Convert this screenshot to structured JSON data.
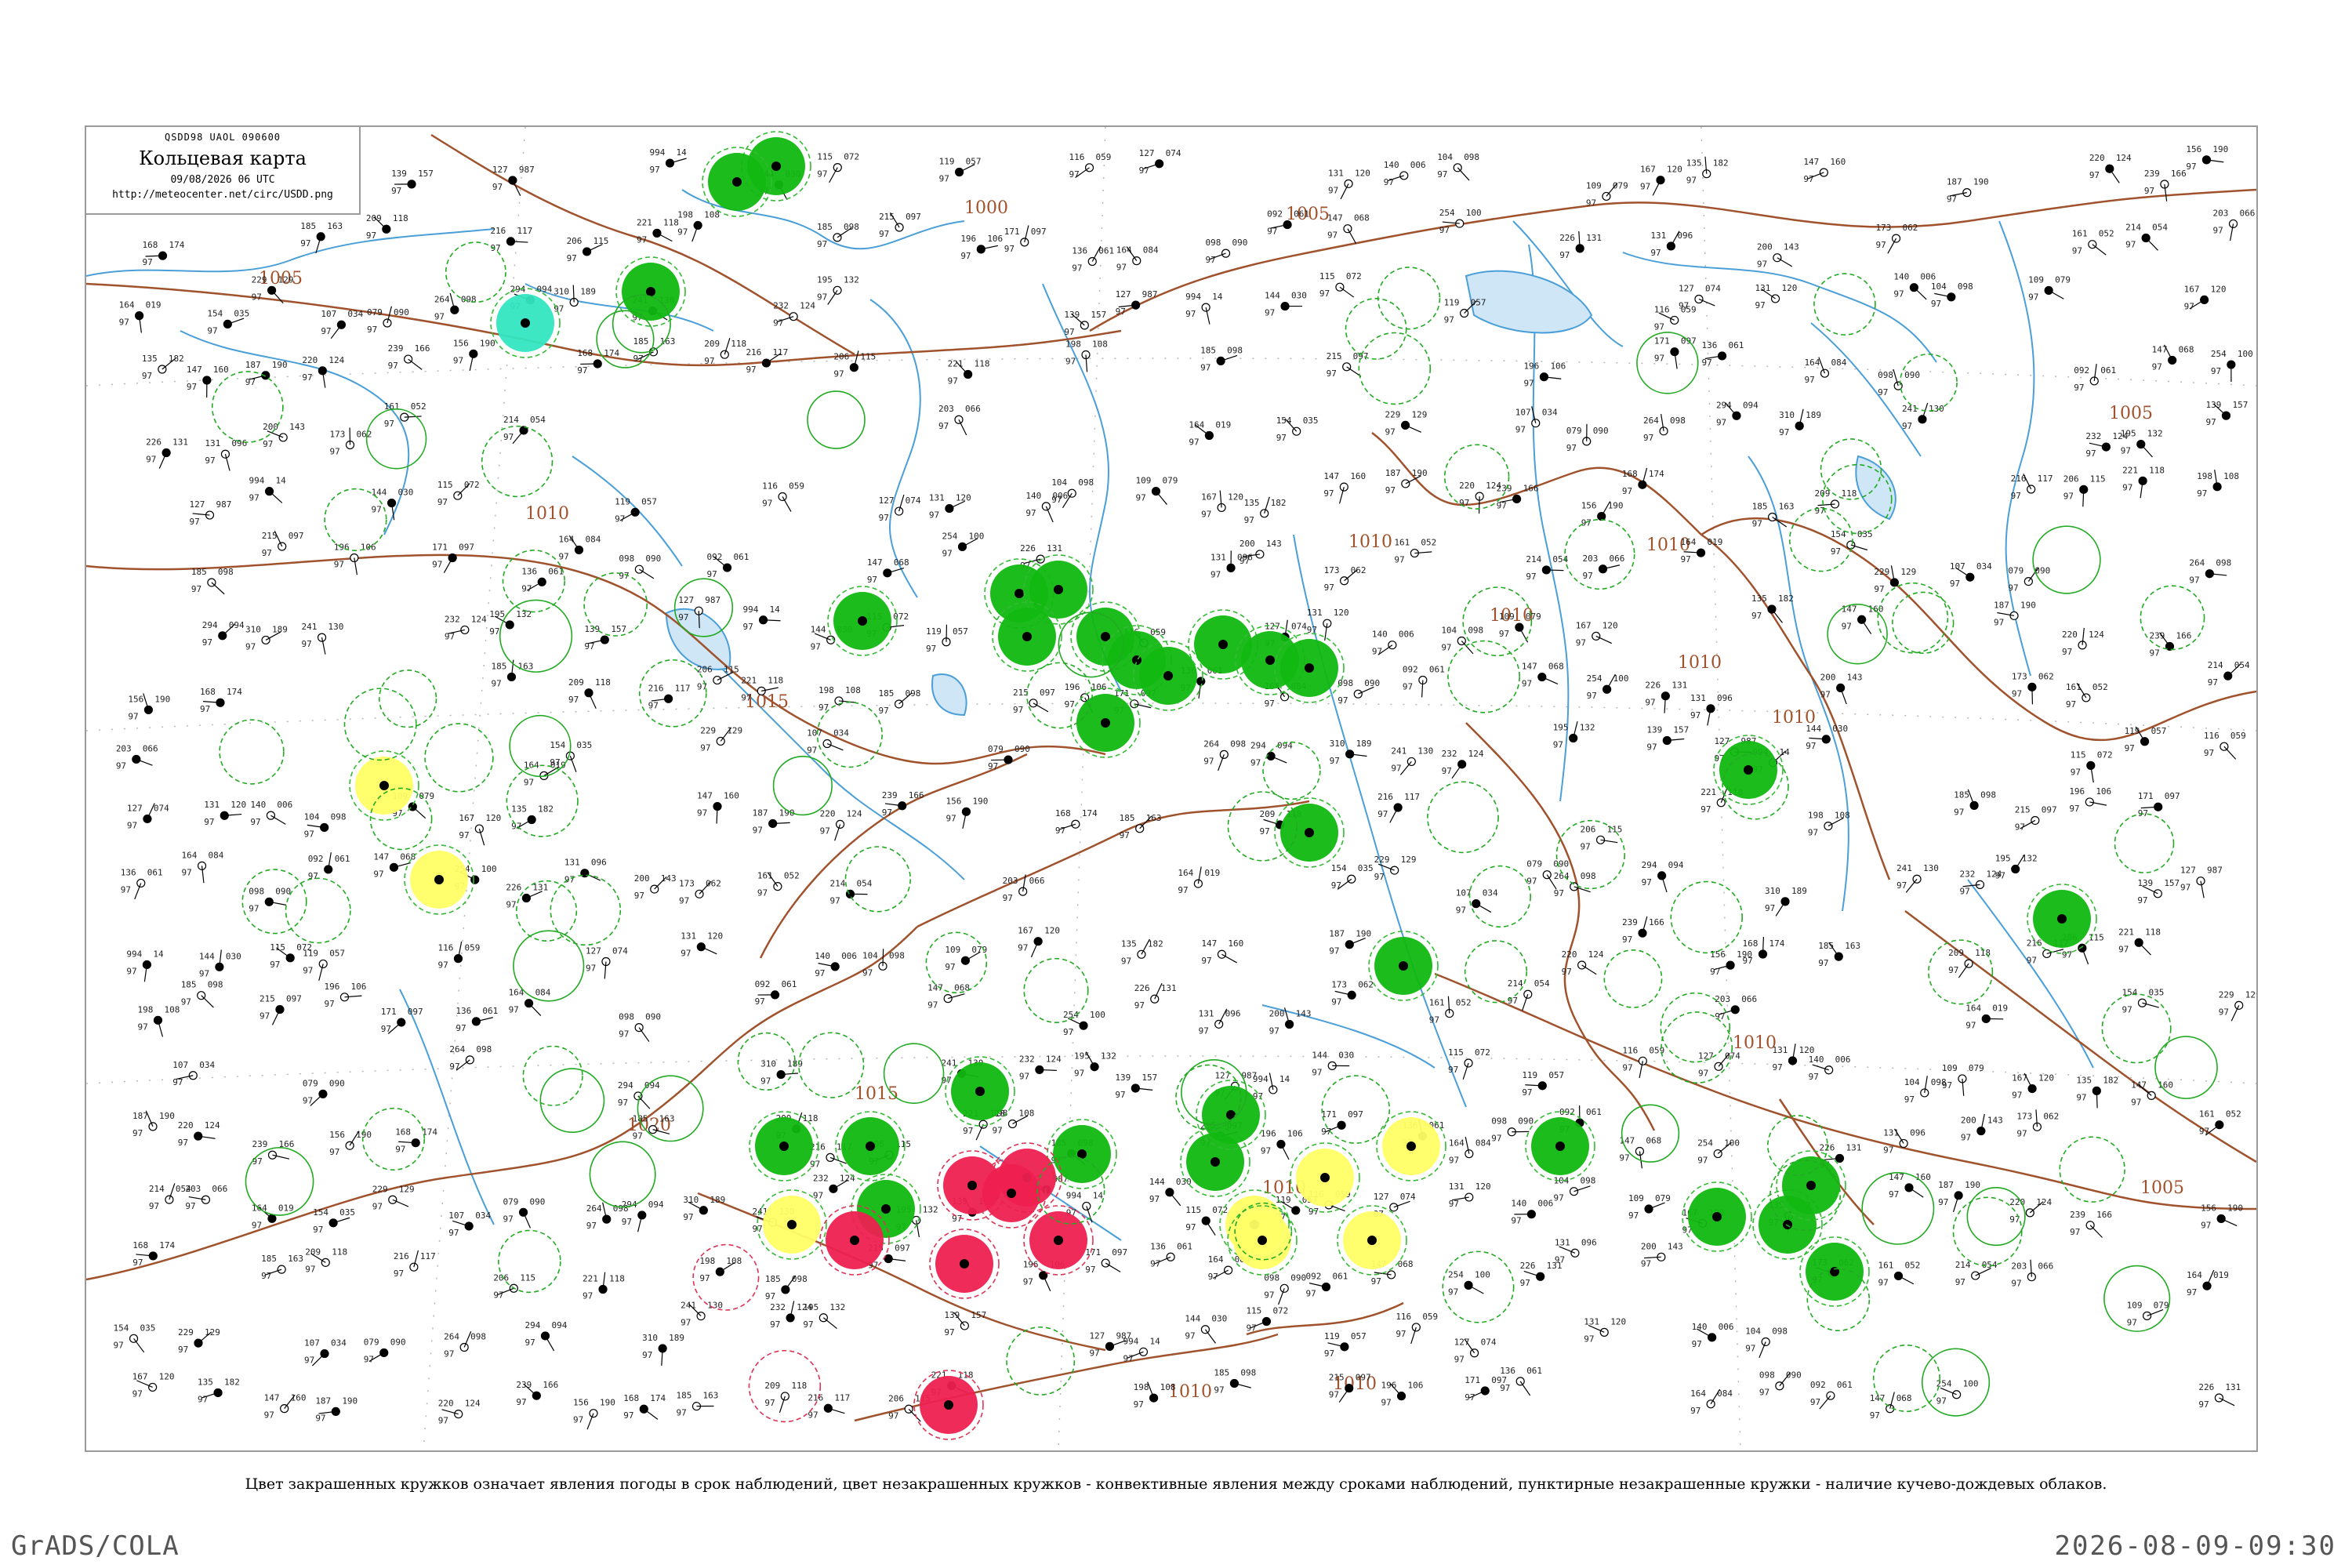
{
  "header": {
    "code_line": "QSDD98  UAOL  090600",
    "title": "Кольцевая карта",
    "valid_time": "09/08/2026 06 UTC",
    "url": "http://meteocenter.net/circ/USDD.png"
  },
  "caption": "Цвет закрашенных кружков означает явления погоды в срок наблюдений, цвет незакрашенных кружков - конвективные явления между сроками наблюдений, пунктирные незакрашенные кружки - наличие кучево-дождевых облаков.",
  "footer": {
    "left": "GrADS/COLA",
    "right": "2026-08-09-09:30"
  },
  "colors": {
    "isobar": "#a0522d",
    "water": "#4a9fd8",
    "dotted_grid": "#b0b0b0",
    "thunderstorm": "#11b811",
    "shower": "#ffff66",
    "hail_or_heavy": "#ee2050",
    "drizzle_fog": "#33e6c0",
    "convective_ring": "#22aa22",
    "cb_dashed_ring": "#33bb33",
    "red_ring": "#dd3355"
  },
  "isobar_labels": [
    "1005",
    "1005",
    "1005",
    "1005",
    "1010",
    "1010",
    "1010",
    "1010",
    "1010",
    "1010",
    "1015",
    "1015",
    "1020",
    "1010",
    "1010",
    "1010",
    "1010",
    "1000"
  ],
  "filled_markers": [
    {
      "kind": "thunderstorm",
      "count": 30
    },
    {
      "kind": "shower",
      "count": 8
    },
    {
      "kind": "hail_or_heavy",
      "count": 7
    },
    {
      "kind": "drizzle_fog",
      "count": 1
    }
  ],
  "sample_obs": [
    {
      "t": "139",
      "p": "157"
    },
    {
      "t": "127",
      "p": "987"
    },
    {
      "t": "994",
      "p": "14"
    },
    {
      "t": "144",
      "p": "030"
    },
    {
      "t": "115",
      "p": "072"
    },
    {
      "t": "119",
      "p": "057"
    },
    {
      "t": "116",
      "p": "059"
    },
    {
      "t": "127",
      "p": "074"
    },
    {
      "t": "131",
      "p": "120"
    },
    {
      "t": "140",
      "p": "006"
    },
    {
      "t": "104",
      "p": "098"
    },
    {
      "t": "109",
      "p": "079"
    },
    {
      "t": "167",
      "p": "120"
    },
    {
      "t": "135",
      "p": "182"
    },
    {
      "t": "147",
      "p": "160"
    },
    {
      "t": "187",
      "p": "190"
    },
    {
      "t": "220",
      "p": "124"
    },
    {
      "t": "239",
      "p": "166"
    },
    {
      "t": "156",
      "p": "190"
    },
    {
      "t": "168",
      "p": "174"
    },
    {
      "t": "185",
      "p": "163"
    },
    {
      "t": "209",
      "p": "118"
    },
    {
      "t": "216",
      "p": "117"
    },
    {
      "t": "206",
      "p": "115"
    },
    {
      "t": "221",
      "p": "118"
    },
    {
      "t": "198",
      "p": "108"
    },
    {
      "t": "185",
      "p": "098"
    },
    {
      "t": "215",
      "p": "097"
    },
    {
      "t": "196",
      "p": "106"
    },
    {
      "t": "171",
      "p": "097"
    },
    {
      "t": "136",
      "p": "061"
    },
    {
      "t": "164",
      "p": "084"
    },
    {
      "t": "098",
      "p": "090"
    },
    {
      "t": "092",
      "p": "061"
    },
    {
      "t": "147",
      "p": "068"
    },
    {
      "t": "254",
      "p": "100"
    },
    {
      "t": "226",
      "p": "131"
    },
    {
      "t": "131",
      "p": "096"
    },
    {
      "t": "200",
      "p": "143"
    },
    {
      "t": "173",
      "p": "062"
    },
    {
      "t": "161",
      "p": "052"
    },
    {
      "t": "214",
      "p": "054"
    },
    {
      "t": "203",
      "p": "066"
    },
    {
      "t": "164",
      "p": "019"
    },
    {
      "t": "154",
      "p": "035"
    },
    {
      "t": "229",
      "p": "129"
    },
    {
      "t": "107",
      "p": "034"
    },
    {
      "t": "079",
      "p": "090"
    },
    {
      "t": "264",
      "p": "098"
    },
    {
      "t": "294",
      "p": "094"
    },
    {
      "t": "310",
      "p": "189"
    },
    {
      "t": "241",
      "p": "130"
    },
    {
      "t": "232",
      "p": "124"
    },
    {
      "t": "195",
      "p": "132"
    }
  ]
}
